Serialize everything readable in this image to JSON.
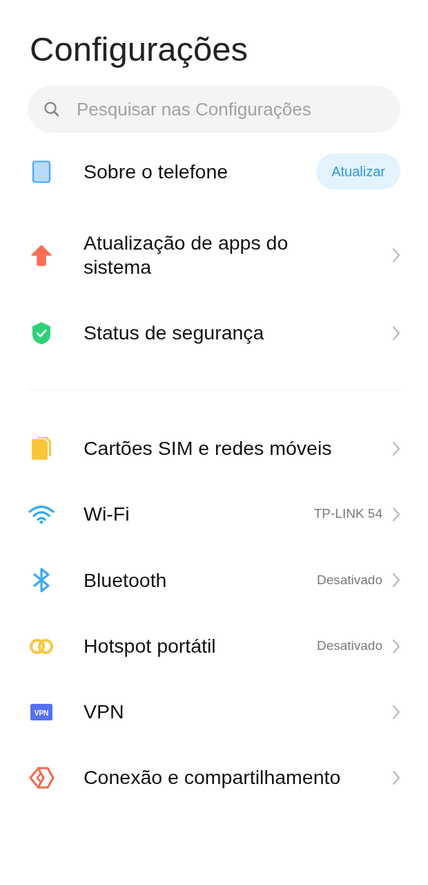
{
  "title": "Configurações",
  "search": {
    "placeholder": "Pesquisar nas Configurações"
  },
  "sections": [
    {
      "items": [
        {
          "label": "Sobre o telefone",
          "kind": "button",
          "button": "Atualizar"
        },
        {
          "label": "Atualização de apps do sistema",
          "kind": "chevron"
        },
        {
          "label": "Status de segurança",
          "kind": "chevron"
        }
      ]
    },
    {
      "items": [
        {
          "label": "Cartões SIM e redes móveis",
          "kind": "chevron"
        },
        {
          "label": "Wi-Fi",
          "kind": "chevron",
          "value": "TP-LINK 54"
        },
        {
          "label": "Bluetooth",
          "kind": "chevron",
          "value": "Desativado"
        },
        {
          "label": "Hotspot portátil",
          "kind": "chevron",
          "value": "Desativado"
        },
        {
          "label": "VPN",
          "kind": "chevron",
          "icon_text": "VPN"
        },
        {
          "label": "Conexão e compartilhamento",
          "kind": "chevron"
        }
      ]
    }
  ]
}
